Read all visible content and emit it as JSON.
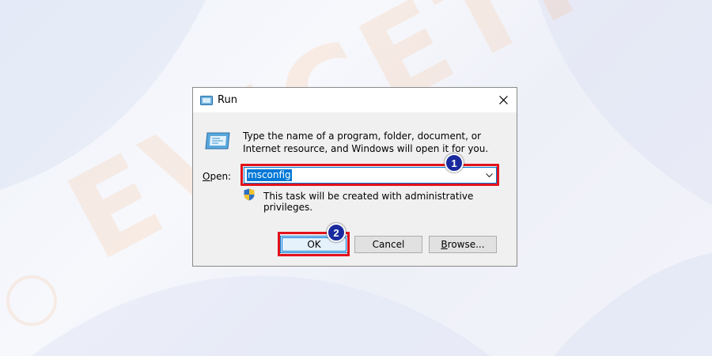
{
  "dialog": {
    "title": "Run",
    "description": "Type the name of a program, folder, document, or Internet resource, and Windows will open it for you.",
    "open_label_underline": "O",
    "open_label_rest": "pen:",
    "input_value": "msconfig",
    "admin_notice": "This task will be created with administrative privileges.",
    "ok_label": "OK",
    "cancel_label": "Cancel",
    "browse_label_underline": "B",
    "browse_label_rest": "rowse..."
  },
  "annotations": {
    "step1": "1",
    "step2": "2",
    "highlight_color": "#e3121b",
    "badge_color": "#1a2a9e"
  },
  "icons": {
    "title": "run-icon",
    "large": "run-icon",
    "close": "close-icon",
    "dropdown": "chevron-down-icon",
    "admin": "shield-icon"
  }
}
